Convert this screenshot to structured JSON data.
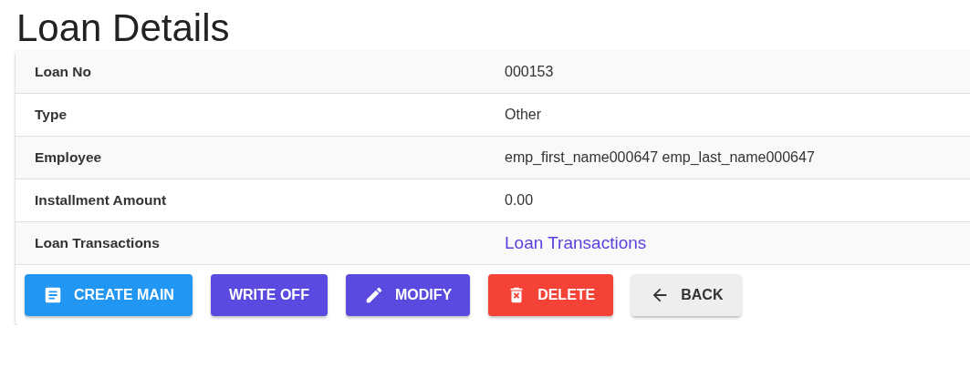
{
  "title": "Loan Details",
  "rows": [
    {
      "label": "Loan No",
      "value": "000153",
      "kind": "text"
    },
    {
      "label": "Type",
      "value": "Other",
      "kind": "text"
    },
    {
      "label": "Employee",
      "value": "emp_first_name000647 emp_last_name000647",
      "kind": "text"
    },
    {
      "label": "Installment Amount",
      "value": "0.00",
      "kind": "text"
    },
    {
      "label": "Loan Transactions",
      "value": "Loan Transactions",
      "kind": "link"
    }
  ],
  "buttons": [
    {
      "label": "CREATE MAIN",
      "kind": "create",
      "color": "#2196f3"
    },
    {
      "label": "WRITE OFF",
      "kind": "plain",
      "color": "#5b4ae0"
    },
    {
      "label": "MODIFY",
      "kind": "edit",
      "color": "#5b4ae0"
    },
    {
      "label": "DELETE",
      "kind": "delete",
      "color": "#f44336"
    },
    {
      "label": "BACK",
      "kind": "back",
      "color": "#eeeeee"
    }
  ]
}
